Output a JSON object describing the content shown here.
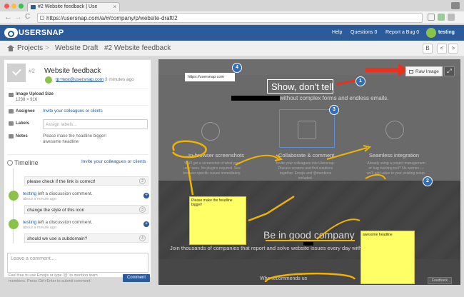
{
  "browser": {
    "tab_title": "#2 Website feedback | Use",
    "tab_close": "×",
    "url": "https://usersnap.com/a/#/company/p/website-draft/2",
    "back": "←",
    "forward": "→",
    "reload": "C"
  },
  "header": {
    "logo": "USERSNAP",
    "nav": {
      "help": "Help",
      "questions": "Questions",
      "questions_badge": "0",
      "report": "Report a Bug",
      "report_badge": "0",
      "user": "testing"
    }
  },
  "breadcrumb": {
    "items": [
      "Projects",
      "Website Draft",
      "#2 Website feedback"
    ],
    "separator": ">",
    "controls": [
      "B",
      "<",
      ">"
    ]
  },
  "issue": {
    "number": "#2",
    "title": "Website feedback",
    "reporter_email": "tp+test@usersnap.com",
    "reported_time": "3 minutes ago",
    "upload_size_label": "Image Upload Size",
    "upload_size_value": "1238 × 916",
    "assignee_label": "Assignee",
    "assignee_value": "Invite your colleagues or clients",
    "labels_label": "Labels",
    "labels_placeholder": "Assign labels...",
    "notes_label": "Notes",
    "notes_lines": [
      "Please make the headline bigger!",
      "awesome headline"
    ]
  },
  "timeline": {
    "title": "Timeline",
    "invite_link": "Invite your colleagues or clients",
    "plus": "+",
    "entries": [
      {
        "text": "please check if the link is correct!",
        "badge": "2"
      },
      {
        "user": "testing",
        "action": "left a discussion comment.",
        "time": "about a minute ago"
      },
      {
        "text": "change the style of this icon",
        "badge": "3"
      },
      {
        "user": "testing",
        "action": "left a discussion comment.",
        "time": "about a minute ago"
      },
      {
        "text": "should we use a subdomain?",
        "badge": "4"
      }
    ]
  },
  "comment": {
    "placeholder": "Leave a comment...",
    "help_text": "Feel free to use Emojis or type '@' to mention team members. Press Ctrl+Enter to submit comment.",
    "send_label": "Comment"
  },
  "screenshot": {
    "raw_image_label": "Raw Image",
    "expand_icon": "⤢",
    "inner_url": "https://usersnap.com",
    "headline": "Show, don't tell",
    "subline": "without complex forms and endless emails.",
    "features": [
      {
        "title": "In-browser screenshots",
        "desc": "You'll get a screenshot of what your user sees. No plugins required. See browser-specific issues immediately."
      },
      {
        "title": "Collaborate & comment",
        "desc": "Invite your colleagues into Usersnap. Discuss screens and find solutions together. Emojis and @mentions included."
      },
      {
        "title": "Seamless integration",
        "desc": "Already using a project management or bug tracking tool? No worries — we'll add value to your existing setup."
      }
    ],
    "band_title": "Be in good company",
    "band_sub": "Join thousands of companies that report and solve website issues every day with the help of Usersnap.",
    "band_bottom": "Who recommends us",
    "sticky_1": "Please make the headline bigger!",
    "sticky_2": "awesome headline",
    "markers": [
      "1",
      "2",
      "3",
      "4"
    ],
    "feedback_tag": "Feedback"
  },
  "colors": {
    "brand": "#2b5b9b",
    "sticky": "#ffff66",
    "arrow": "#f0b400",
    "marker": "#2f6eb8",
    "accent_red": "#e53320"
  }
}
